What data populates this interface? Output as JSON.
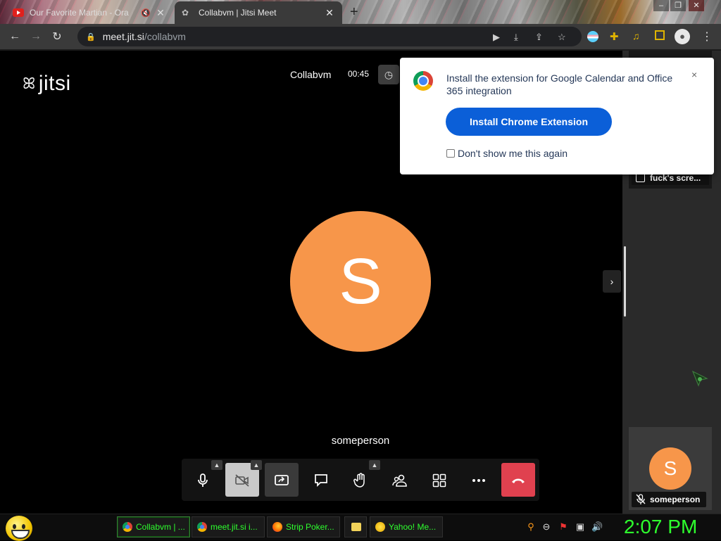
{
  "browser": {
    "tabs": [
      {
        "title": "Our Favorite Martian - Ora",
        "icon": "youtube-icon",
        "audio": "speaker-muted-icon"
      },
      {
        "title": "Collabvm | Jitsi Meet",
        "icon": "jitsi-favicon"
      }
    ],
    "new_tab_label": "+",
    "close_glyph": "✕",
    "url_host": "meet.jit.si",
    "url_path": "/collabvm"
  },
  "meeting": {
    "logo_text": "jitsi",
    "conference_name": "Collabvm",
    "timer": "00:45",
    "main_avatar_letter": "S",
    "main_participant_name": "someperson",
    "avatar_color": "#f7964a"
  },
  "toolbar": {
    "buttons": [
      "microphone",
      "camera-off",
      "share-screen",
      "chat",
      "raise-hand",
      "participants",
      "tile-view",
      "more",
      "hangup"
    ],
    "hangup_color": "#e0414f"
  },
  "filmstrip": {
    "thumb1_label": "fuck's scre...",
    "thumb2_avatar_letter": "S",
    "thumb2_name": "someperson"
  },
  "popup": {
    "message": "Install the extension for Google Calendar and Office 365 integration",
    "install_button": "Install Chrome Extension",
    "checkbox_label": "Don't show me this again",
    "close_glyph": "×",
    "button_color": "#0b5fd8"
  },
  "taskbar": {
    "tasks": [
      {
        "label": "Collabvm | ...",
        "icon": "chrome-icon"
      },
      {
        "label": "meet.jit.si i...",
        "icon": "chrome-icon"
      },
      {
        "label": "Strip Poker...",
        "icon": "firefox-icon"
      },
      {
        "label": "Yahoo! Me...",
        "icon": "yahoo-messenger-icon"
      }
    ],
    "clock": "2:07 PM",
    "clock_color": "#2eff2e"
  }
}
